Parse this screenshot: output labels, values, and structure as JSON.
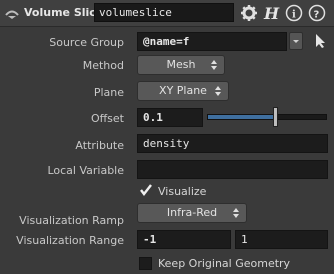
{
  "header": {
    "node_type": "Volume Slice",
    "node_name": "volumeslice",
    "icons": [
      "node-menu-icon",
      "gear-icon",
      "help-h-icon",
      "info-icon",
      "question-icon"
    ]
  },
  "params": {
    "source_group": {
      "label": "Source Group",
      "value": "@name=f"
    },
    "method": {
      "label": "Method",
      "value": "Mesh"
    },
    "plane": {
      "label": "Plane",
      "value": "XY Plane"
    },
    "offset": {
      "label": "Offset",
      "value": "0.1",
      "slider_fraction": 0.55
    },
    "attribute": {
      "label": "Attribute",
      "value": "density"
    },
    "local_variable": {
      "label": "Local Variable",
      "value": ""
    },
    "visualize": {
      "label": "Visualize",
      "checked": true
    },
    "vis_ramp": {
      "label": "Visualization Ramp",
      "value": "Infra-Red"
    },
    "vis_range": {
      "label": "Visualization Range",
      "min": "-1",
      "max": "1"
    },
    "keep_original": {
      "label": "Keep Original Geometry",
      "checked": false
    }
  },
  "colors": {
    "accent": "#3f6f9f",
    "field_bg": "#1c1c1c",
    "panel_bg": "#3a3a3a"
  }
}
